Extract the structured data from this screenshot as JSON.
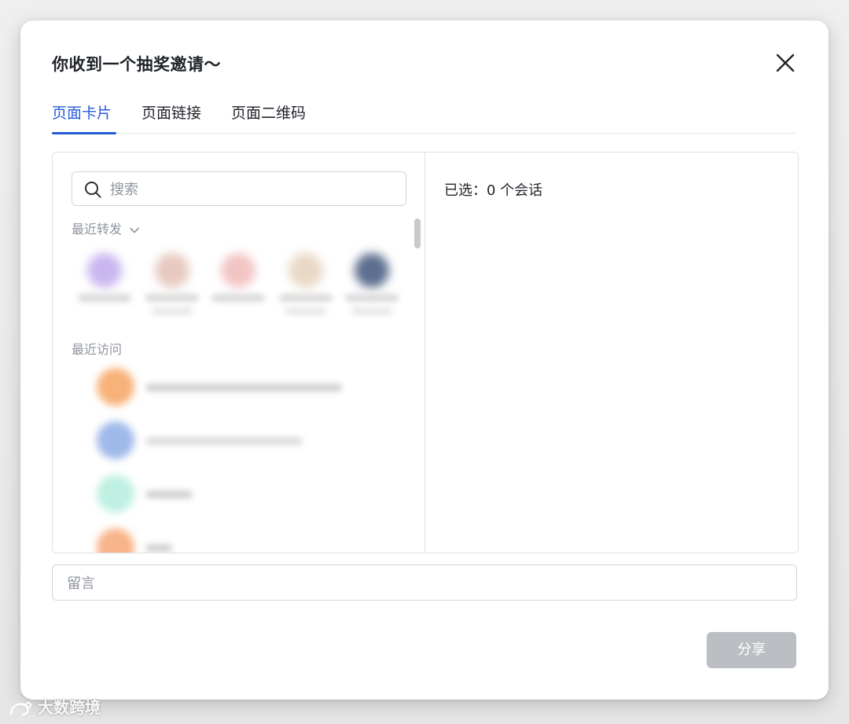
{
  "dialog": {
    "title": "你收到一个抽奖邀请～",
    "tabs": [
      {
        "label": "页面卡片",
        "active": true
      },
      {
        "label": "页面链接",
        "active": false
      },
      {
        "label": "页面二维码",
        "active": false
      }
    ],
    "search": {
      "placeholder": "搜索"
    },
    "recent_forward_label": "最近转发",
    "recent_visit_label": "最近访问",
    "recent_forward_count": 5,
    "recent_visit_count": 4,
    "selected_label": "已选：0 个会话",
    "message": {
      "placeholder": "留言"
    },
    "share_label": "分享"
  },
  "watermark": {
    "text": "大数跨境"
  },
  "colors": {
    "accent": "#245bdb",
    "text": "#1f2329",
    "muted": "#8f959e",
    "disabled_button": "#bbbfc4",
    "border": "#dee0e3"
  }
}
